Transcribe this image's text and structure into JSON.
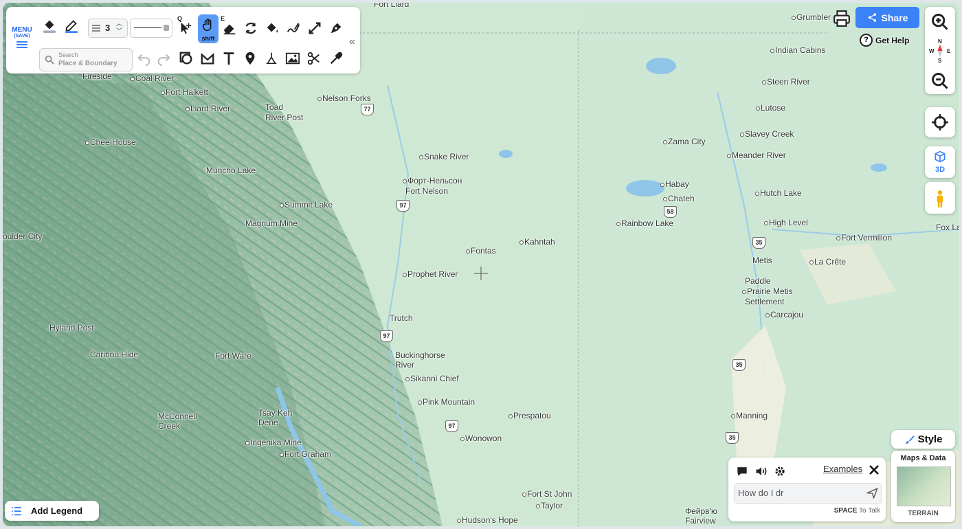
{
  "toolbar": {
    "menu_label": "MENU",
    "menu_sub": "(SAVE)",
    "line_width": "3",
    "search_label": "Search",
    "search_sub": "Place & Boundary",
    "select_hotkey": "Q",
    "pan_hotkey": "E",
    "pan_label": "shift"
  },
  "top_right": {
    "share_label": "Share",
    "help_label": "Get Help"
  },
  "compass": {
    "n": "N",
    "s": "S",
    "e": "E",
    "w": "W"
  },
  "side": {
    "three_d_label": "3D",
    "style_label": "Style",
    "maps_data_label": "Maps & Data",
    "terrain_label": "TERRAIN"
  },
  "legend": {
    "add_label": "Add Legend"
  },
  "assistant": {
    "examples_label": "Examples",
    "input_value": "How do I dr",
    "hint_key": "SPACE",
    "hint_text": "To Talk"
  },
  "map": {
    "places": [
      "Fort Liard",
      "Fireside",
      "Coal River",
      "Fort Halkett",
      "Liard River",
      "Toad",
      "River Post",
      "Nelson Forks",
      "Chee House",
      "Muncho Lake",
      "Snake River",
      "Форт-Нельсон",
      "Fort Nelson",
      "Summit Lake",
      "Magnum Mine",
      "oulder City",
      "Kahntah",
      "Fontas",
      "Prophet River",
      "Trutch",
      "Hyland Post",
      "Caribou Hide",
      "Fort Ware",
      "Buckinghorse",
      "River",
      "Sikanni Chief",
      "Pink Mountain",
      "Prespatou",
      "McConnell",
      "Creek",
      "Tsay Keh",
      "Dene",
      "Ingenika Mine",
      "Fort Graham",
      "Wonowon",
      "Fort St John",
      "Taylor",
      "Hudson's Hope",
      "Grumbler",
      "Indian Cabins",
      "Steen River",
      "Lutose",
      "Slavey Creek",
      "Zama City",
      "Meander River",
      "Habay",
      "Chateh",
      "Hutch Lake",
      "Rainbow Lake",
      "High Level",
      "Fox La",
      "Fort Vermilion",
      "Metis",
      "La Crête",
      "Paddle",
      "Prairie Metis",
      "Settlement",
      "Carcajou",
      "Manning",
      "Фейрв'ю",
      "Fairview"
    ],
    "route_shields": [
      "77",
      "97",
      "97",
      "97",
      "58",
      "35",
      "35",
      "35"
    ]
  },
  "colors": {
    "accent": "#3b82f6",
    "share_bg": "#3b82f6",
    "active_tool_bg": "#5b9bf5",
    "map_plains": "#cfe8d3",
    "map_mountains": "#8fb9a0",
    "water": "#8fc5e8"
  }
}
